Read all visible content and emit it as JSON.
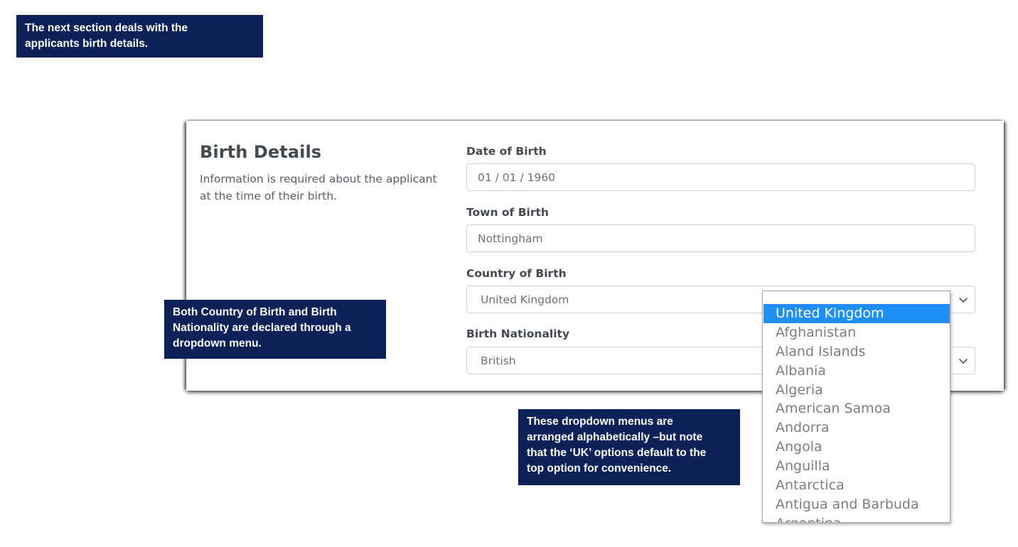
{
  "callouts": {
    "intro": [
      "The next section deals with the",
      "applicants birth details."
    ],
    "dropdown_note": [
      "Both Country of Birth and Birth",
      "Nationality are declared through a",
      "dropdown menu."
    ],
    "alphabetical_note": [
      "These dropdown menus are",
      "arranged alphabetically –but note",
      "that the ‘UK’ options default to the",
      "top option for convenience."
    ]
  },
  "section": {
    "title": "Birth Details",
    "description": "Information is required about the applicant at the time of their birth."
  },
  "form": {
    "date_of_birth": {
      "label": "Date of Birth",
      "value": "01 / 01 / 1960"
    },
    "town_of_birth": {
      "label": "Town of Birth",
      "value": "Nottingham"
    },
    "country_of_birth": {
      "label": "Country of Birth",
      "value": "United Kingdom"
    },
    "birth_nationality": {
      "label": "Birth Nationality",
      "value": "British"
    }
  },
  "dropdown": {
    "selected_index": 0,
    "options": [
      "United Kingdom",
      "Afghanistan",
      "Aland Islands",
      "Albania",
      "Algeria",
      "American Samoa",
      "Andorra",
      "Angola",
      "Anguilla",
      "Antarctica",
      "Antigua and Barbuda",
      "Argentina"
    ]
  },
  "colors": {
    "callout_bg": "#0b2158",
    "selected_option_bg": "#1f8ff5"
  }
}
